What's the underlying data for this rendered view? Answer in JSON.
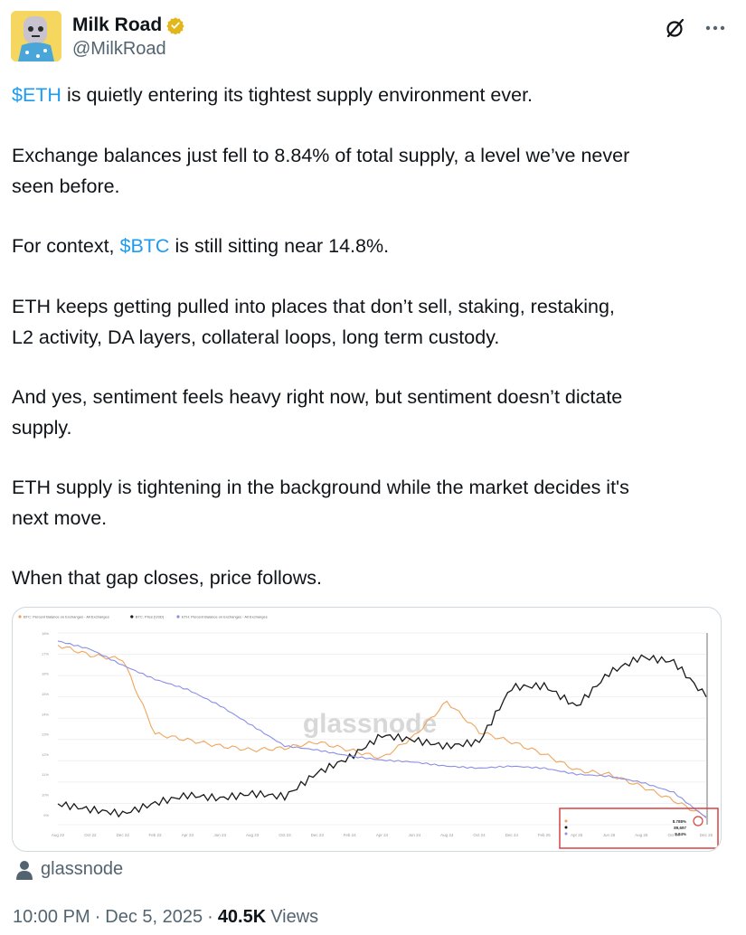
{
  "author": {
    "name": "Milk Road",
    "handle": "@MilkRoad",
    "verified_color": "#e2b719"
  },
  "tweet": {
    "p1": {
      "cashtag": "$ETH",
      "rest": " is quietly entering its tightest supply environment ever."
    },
    "p2": {
      "line1": "Exchange balances just fell to 8.84% of total supply, a level we’ve never",
      "line2": "seen before."
    },
    "p3": {
      "before": "For context, ",
      "cashtag": "$BTC",
      "after": " is still sitting near 14.8%."
    },
    "p4": {
      "line1": "ETH keeps getting pulled into places that don’t sell, staking, restaking,",
      "line2": "L2 activity, DA layers, collateral loops, long term custody."
    },
    "p5": {
      "line1": "And yes, sentiment feels heavy right now, but sentiment doesn’t dictate",
      "line2": "supply."
    },
    "p6": {
      "line1": "ETH supply is tightening in the background while the market decides it's",
      "line2": "next move."
    },
    "p7": "When that gap closes, price follows."
  },
  "colors": {
    "cashtag": "#1d9bf0",
    "btc_balance_line": "#f0a45a",
    "btc_price_line": "#1a1a1a",
    "eth_balance_line": "#8a8fe8",
    "highlight_box": "#d94040"
  },
  "media": {
    "watermark": "glassnode",
    "source_label": "glassnode"
  },
  "meta": {
    "time": "10:00 PM",
    "date": "Dec 5, 2025",
    "views_count": "40.5K",
    "views_label": "Views"
  },
  "chart_data": {
    "type": "line",
    "title": "",
    "x": [
      "Aug 22",
      "Oct 22",
      "Dec 22",
      "Feb 23",
      "Apr 23",
      "Jun 23",
      "Aug 23",
      "Oct 23",
      "Dec 23",
      "Feb 24",
      "Apr 24",
      "Jun 24",
      "Aug 24",
      "Oct 24",
      "Dec 24",
      "Feb 25",
      "Apr 25",
      "Jun 25",
      "Aug 25",
      "Oct 25",
      "Dec 25"
    ],
    "series": [
      {
        "name": "BTC: Percent Balance on Exchanges",
        "axis": "left",
        "values": [
          17.4,
          16.9,
          16.7,
          13.0,
          12.7,
          12.4,
          12.2,
          12.3,
          12.6,
          12.2,
          11.8,
          12.9,
          14.6,
          13.1,
          12.6,
          12.0,
          11.2,
          11.0,
          10.4,
          9.7,
          8.9
        ]
      },
      {
        "name": "BTC: Price [USD]",
        "axis": "right",
        "values": [
          23000,
          19500,
          16800,
          23500,
          28500,
          26500,
          29500,
          27500,
          42500,
          52000,
          66000,
          63000,
          59000,
          62000,
          96000,
          97000,
          84000,
          105000,
          115000,
          112000,
          90000
        ]
      },
      {
        "name": "ETH: Percent Balance on Exchanges",
        "axis": "left",
        "values": [
          17.6,
          17.2,
          16.4,
          15.7,
          15.2,
          14.4,
          13.4,
          12.4,
          12.2,
          11.9,
          11.7,
          11.6,
          11.4,
          11.3,
          11.4,
          11.3,
          11.0,
          10.9,
          10.6,
          10.1,
          8.84
        ]
      }
    ],
    "legend_labels": [
      "BTC: Percent Balance on Exchanges - All Exchanges",
      "BTC: Price [USD]",
      "ETH: Percent Balance on Exchanges - All Exchanges"
    ],
    "legend_position": "top-left",
    "highlight_readout": [
      "8.788%",
      "89,697",
      "8.84%"
    ],
    "grid": true
  }
}
